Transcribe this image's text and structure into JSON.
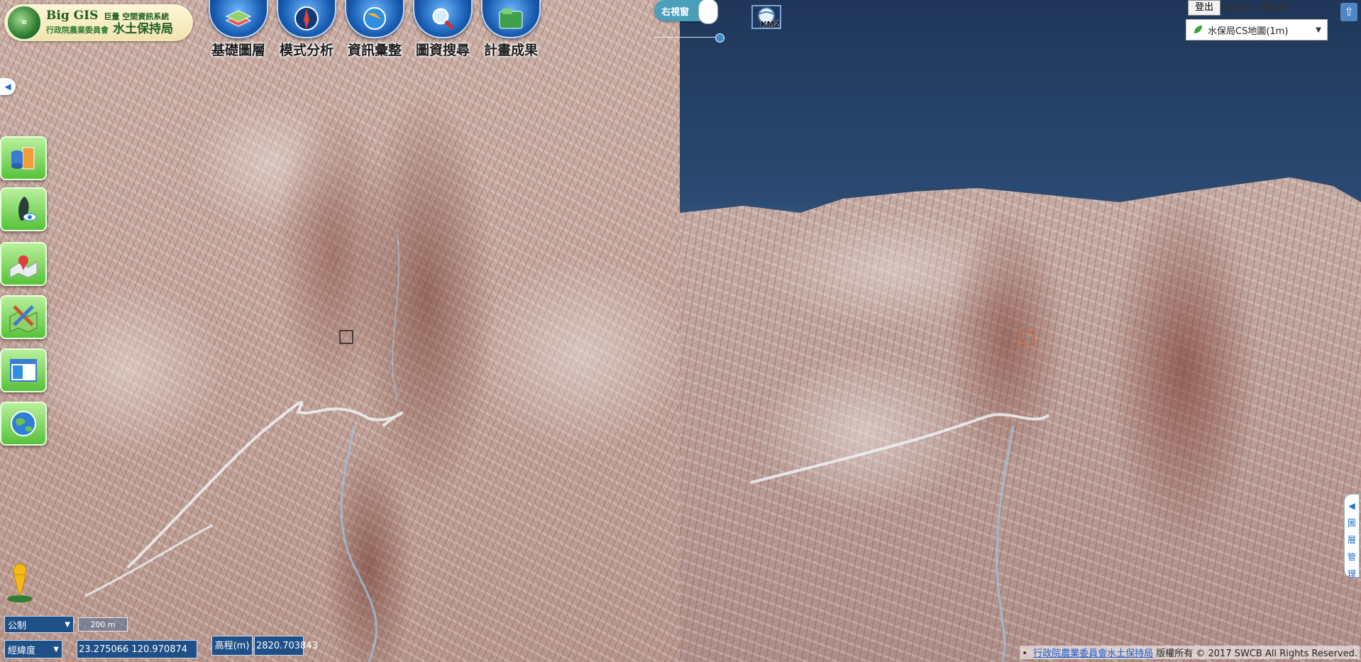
{
  "logo": {
    "big_gis": "Big GIS",
    "system": "巨量 空間資訊系統",
    "coa": "行政院農業委員會",
    "swcb": "水土保持局"
  },
  "nav": [
    {
      "label": "基礎圖層",
      "icon": "layers-icon"
    },
    {
      "label": "模式分析",
      "icon": "compass-analysis-icon"
    },
    {
      "label": "資訊彙整",
      "icon": "globe-info-icon"
    },
    {
      "label": "圖資搜尋",
      "icon": "search-map-icon"
    },
    {
      "label": "計畫成果",
      "icon": "folder-results-icon"
    }
  ],
  "split_toggle": {
    "label": "右視窗"
  },
  "kmz": {
    "label": "KMZ"
  },
  "header_right": {
    "logout": "登出",
    "user": "使用者：陳昭孝",
    "basemap_selected": "水保局CS地圖(1m)",
    "fullscreen_glyph": "⇧"
  },
  "left_collapse_glyph": "◀",
  "tools": [
    {
      "name": "layer-db-icon"
    },
    {
      "name": "taiwan-view-icon"
    },
    {
      "name": "map-pin-icon"
    },
    {
      "name": "map-draw-icon"
    },
    {
      "name": "window-compare-icon"
    },
    {
      "name": "earth-icon"
    }
  ],
  "bottom_left": {
    "unit_select": "公制",
    "scale_label": "200 m",
    "coord_type_select": "經緯度",
    "coordinates": "23.275066 120.970874",
    "elevation_label": "高程(m)",
    "elevation_value": "2820.703843"
  },
  "layer_tab": {
    "arrow": "◀",
    "chars": [
      "圖",
      "層",
      "管",
      "理"
    ]
  },
  "footer": {
    "link": "行政院農業委員會水土保持局",
    "copyright": "版權所有 © 2017 SWCB All Rights Reserved."
  },
  "colors": {
    "nav_blue": "#1a5fb4",
    "tool_green": "#57c23a",
    "panel_blue": "#1f4f87",
    "toggle": "#4a9fba"
  }
}
